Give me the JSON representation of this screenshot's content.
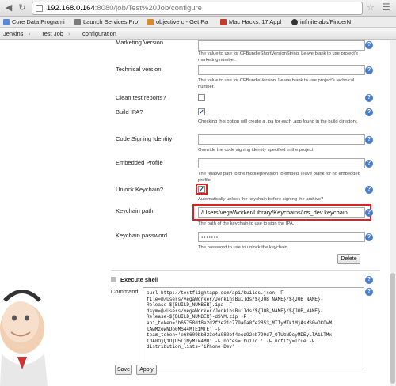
{
  "browser": {
    "url_host": "192.168.0.164",
    "url_path": ":8080/job/Test%20Job/configure",
    "bookmarks": [
      {
        "label": "Core Data Programi",
        "color": "#5a8ad6"
      },
      {
        "label": "Launch Services Pro",
        "color": "#7a7a7a"
      },
      {
        "label": "objective c - Get Pa",
        "color": "#d98a2b"
      },
      {
        "label": "Mac Hacks: 17 Appl",
        "color": "#c63a2b"
      },
      {
        "label": "infinitelabs/FinderN",
        "color": "#333333"
      }
    ]
  },
  "breadcrumb": [
    "Jenkins",
    "Test Job",
    "configuration"
  ],
  "fields": {
    "marketing_version_label": "Marketing Version",
    "marketing_version_desc": "The value to use for CFBundleShortVersionString. Leave blank to use project's marketing number.",
    "technical_version_label": "Technical version",
    "technical_version_desc": "The value to use for CFBundleVersion. Leave blank to use project's technical number.",
    "clean_test_reports_label": "Clean test reports?",
    "build_ipa_label": "Build IPA?",
    "build_ipa_desc": "Checking this option will create a .ipa for each .app found in the build directory.",
    "code_signing_label": "Code Signing Identity",
    "code_signing_desc": "Override the code signing identity specified in the project",
    "embedded_profile_label": "Embedded Profile",
    "embedded_profile_desc": "The relative path to the mobileprovision to embed, leave blank for no embedded profile",
    "unlock_keychain_label": "Unlock Keychain?",
    "unlock_keychain_desc": "Automatically unlock the keychain before signing the archive?",
    "keychain_path_label": "Keychain path",
    "keychain_path_value": "/Users/vegaWorker/Library/Keychains/ios_dev.keychain",
    "keychain_path_desc": "The path of the keychain to use to sign the IPA.",
    "keychain_password_label": "Keychain password",
    "keychain_password_value": "•••••••",
    "keychain_password_desc": "The password to use to unlock the keychain.",
    "delete_label": "Delete"
  },
  "execute_shell": {
    "title": "Execute shell",
    "command_label": "Command",
    "lines": [
      "curl http://testflightapp.com/api/builds.json -F",
      "file=@/Users/vegaWorker/JenkinsBuilds/${JOB_NAME}/${JOB_NAME}-",
      "Release-${BUILD_NUMBER}.ipa -F",
      "dsym=@/Users/vegaWorker/JenkinsBuilds/${JOB_NAME}/${JOB_NAME}-",
      "Release-${BUILD_NUMBER}-dSYM.zip -F",
      "api_token='b65758d18e2d2f2e21c779a0a0fe2853_MTIyMTk1MjAsMS0wOCOwM",
      "lAwMzowNDo0MS44MTE1MTE' -F",
      "team_token='e68609bb823e4a080bf4ecd92eb799d7_OTUzNDcyMDEyLTA1LTMx",
      "IDA0OjQ1OjU5LjMyMTk4MQ' -F notes='build.' -F notify=True -F",
      "distribution_lists='iPhone Dev'"
    ]
  },
  "buttons": {
    "save": "Save",
    "apply": "Apply"
  },
  "colors": {
    "highlight": "#e02020",
    "help": "#4a7cc7"
  }
}
